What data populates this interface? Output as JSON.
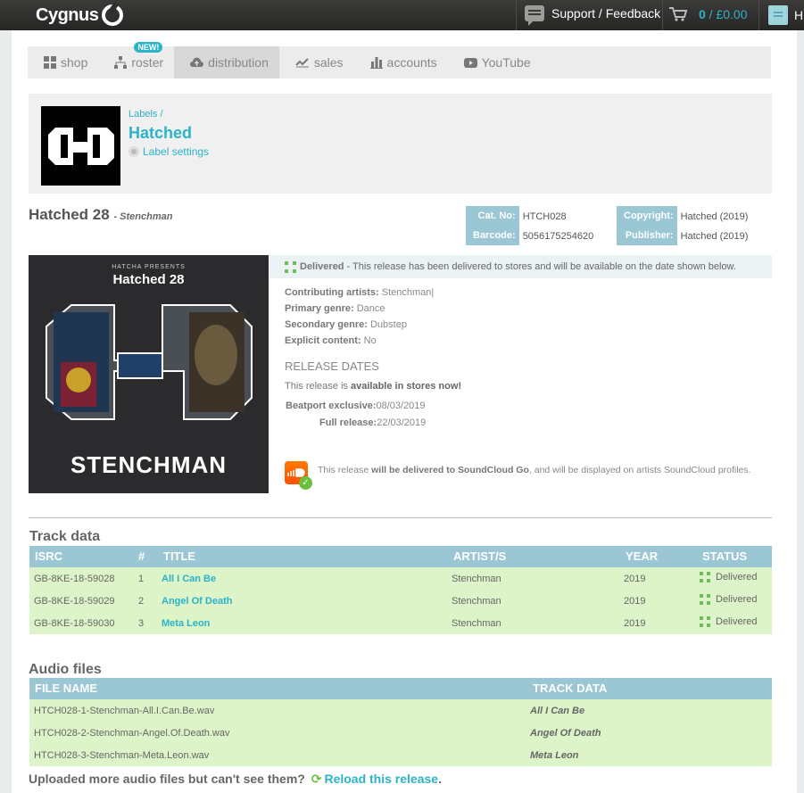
{
  "topbar": {
    "logo": "Cygnus",
    "support_label": "Support / Feedback",
    "cart_count": "0",
    "cart_total": "£0.00",
    "user_initial": "H"
  },
  "nav": {
    "items": [
      {
        "label": "shop",
        "icon": "grid-icon"
      },
      {
        "label": "roster",
        "icon": "hierarchy-icon",
        "badge": "NEW!"
      },
      {
        "label": "distribution",
        "icon": "cloud-upload-icon"
      },
      {
        "label": "sales",
        "icon": "line-chart-icon"
      },
      {
        "label": "accounts",
        "icon": "bar-chart-icon"
      },
      {
        "label": "YouTube",
        "icon": "youtube-icon"
      }
    ],
    "active": "distribution"
  },
  "label": {
    "breadcrumb": "Labels /",
    "name": "Hatched",
    "settings_link": "Label settings"
  },
  "release": {
    "title": "Hatched 28",
    "artist_suffix": "- Stenchman",
    "cat_no_label": "Cat. No:",
    "cat_no": "HTCH028",
    "barcode_label": "Barcode:",
    "barcode": "5056175254620",
    "copyright_label": "Copyright:",
    "copyright": "Hatched (2019)",
    "publisher_label": "Publisher:",
    "publisher": "Hatched (2019)",
    "cover": {
      "presents": "HATCHA PRESENTS",
      "title": "Hatched 28",
      "artist": "STENCHMAN"
    },
    "status_label": "Delivered",
    "status_text": "- This release has been delivered to stores and will be available on the date shown below.",
    "contributing_label": "Contributing artists:",
    "contributing": "Stenchman|",
    "primary_genre_label": "Primary genre:",
    "primary_genre": "Dance",
    "secondary_genre_label": "Secondary genre:",
    "secondary_genre": "Dubstep",
    "explicit_label": "Explicit content:",
    "explicit": "No",
    "dates_title": "RELEASE DATES",
    "avail_prefix": "This release is",
    "avail_bold": "available in stores now!",
    "beatport_label": "Beatport exclusive:",
    "beatport_date": "08/03/2019",
    "full_label": "Full release:",
    "full_date": "22/03/2019",
    "sc_prefix": "This release",
    "sc_bold": "will be delivered to SoundCloud Go",
    "sc_suffix": ", and will be displayed on artists SoundCloud profiles."
  },
  "tracks": {
    "title": "Track data",
    "headers": {
      "isrc": "ISRC",
      "num": "#",
      "title": "TITLE",
      "artist": "ARTIST/S",
      "year": "YEAR",
      "status": "STATUS"
    },
    "rows": [
      {
        "isrc": "GB-8KE-18-59028",
        "num": "1",
        "title": "All I Can Be",
        "artist": "Stenchman",
        "year": "2019",
        "status": "Delivered"
      },
      {
        "isrc": "GB-8KE-18-59029",
        "num": "2",
        "title": "Angel Of Death",
        "artist": "Stenchman",
        "year": "2019",
        "status": "Delivered"
      },
      {
        "isrc": "GB-8KE-18-59030",
        "num": "3",
        "title": "Meta Leon",
        "artist": "Stenchman",
        "year": "2019",
        "status": "Delivered"
      }
    ]
  },
  "audio": {
    "title": "Audio files",
    "headers": {
      "file": "FILE NAME",
      "track": "TRACK DATA"
    },
    "rows": [
      {
        "file": "HTCH028-1-Stenchman-All.I.Can.Be.wav",
        "track": "All I Can Be"
      },
      {
        "file": "HTCH028-2-Stenchman-Angel.Of.Death.wav",
        "track": "Angel Of Death"
      },
      {
        "file": "HTCH028-3-Stenchman-Meta.Leon.wav",
        "track": "Meta Leon"
      }
    ]
  },
  "footer": {
    "question": "Uploaded more audio files but can't see them?",
    "reload_link": "Reload this release",
    "period": "."
  },
  "colors": {
    "accent": "#2bb3c8",
    "header_blue": "#9bc6d3",
    "row_green": "#dcf4c8",
    "delivered_green": "#6cbf5a"
  }
}
